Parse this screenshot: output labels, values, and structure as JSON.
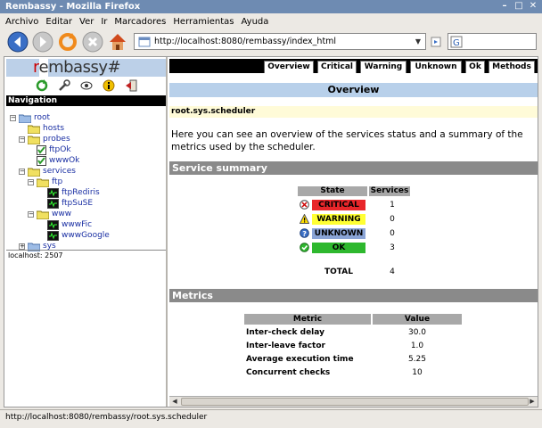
{
  "window": {
    "title": "Rembassy - Mozilla Firefox"
  },
  "menu": [
    "Archivo",
    "Editar",
    "Ver",
    "Ir",
    "Marcadores",
    "Herramientas",
    "Ayuda"
  ],
  "urlbar": {
    "value": "http://localhost:8080/rembassy/index_html"
  },
  "logo": {
    "text_r": "r",
    "text_e": "e",
    "text_rest": "mbassy",
    "cursor": "#"
  },
  "nav": {
    "header": "Navigation",
    "tree": [
      "root",
      "hosts",
      "probes",
      "ftpOk",
      "wwwOk",
      "services",
      "ftp",
      "ftpRediris",
      "ftpSuSE",
      "www",
      "wwwFic",
      "wwwGoogle",
      "sys"
    ],
    "status": "localhost: 2507"
  },
  "tabs": [
    "Overview",
    "Critical",
    "Warning",
    "Unknown",
    "Ok",
    "Methods"
  ],
  "main": {
    "title": "Overview",
    "path": "root.sys.scheduler",
    "intro": "Here you can see an overview of the services status and a summary of the metrics used by the scheduler.",
    "service_summary": {
      "heading": "Service summary",
      "col_state": "State",
      "col_services": "Services",
      "rows": [
        {
          "state": "CRITICAL",
          "count": "1",
          "color": "#e8262a"
        },
        {
          "state": "WARNING",
          "count": "0",
          "color": "#ffff33"
        },
        {
          "state": "UNKNOWN",
          "count": "0",
          "color": "#8aa4d6"
        },
        {
          "state": "OK",
          "count": "3",
          "color": "#2eb82e"
        }
      ],
      "total_label": "TOTAL",
      "total": "4"
    },
    "metrics": {
      "heading": "Metrics",
      "col_metric": "Metric",
      "col_value": "Value",
      "rows": [
        {
          "metric": "Inter-check delay",
          "value": "30.0"
        },
        {
          "metric": "Inter-leave factor",
          "value": "1.0"
        },
        {
          "metric": "Average execution time",
          "value": "5.25"
        },
        {
          "metric": "Concurrent checks",
          "value": "10"
        }
      ]
    }
  },
  "statusbar": {
    "text": "http://localhost:8080/rembassy/root.sys.scheduler"
  }
}
